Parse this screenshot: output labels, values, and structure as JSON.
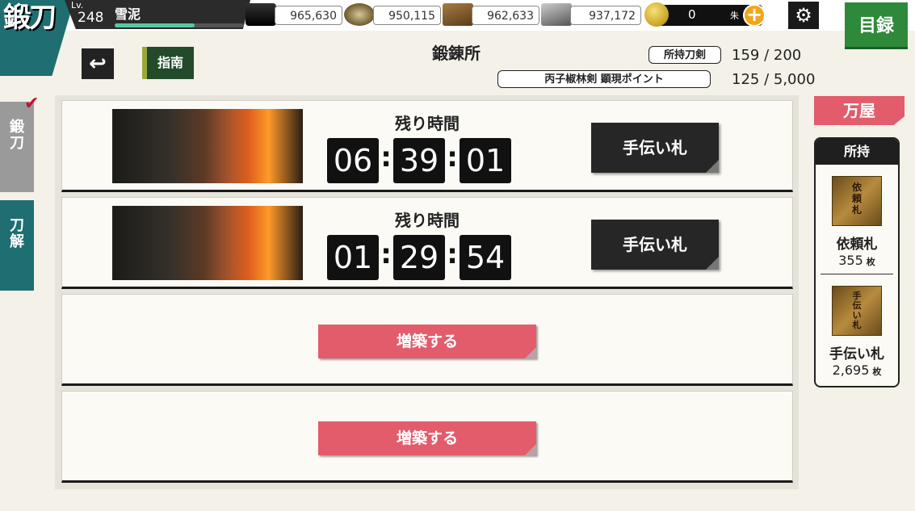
{
  "header": {
    "section_title": "鍛刀",
    "level_label": "Lv.",
    "level": "248",
    "player_name": "雪泥",
    "xp_progress": 0.62,
    "resources": [
      {
        "name": "charcoal",
        "icon": "charcoal-icon",
        "value": "965,630"
      },
      {
        "name": "tamahagane",
        "icon": "tamahagane-icon",
        "value": "950,115"
      },
      {
        "name": "cooling-material",
        "icon": "cooling-material-icon",
        "value": "962,633"
      },
      {
        "name": "whetstone",
        "icon": "whetstone-icon",
        "value": "937,172"
      }
    ],
    "currency": {
      "value": "0",
      "unit": "朱"
    },
    "catalog_label": "目録"
  },
  "subheader": {
    "guide_label": "指南",
    "page_title": "鍛錬所",
    "owned_swords_label": "所持刀剣",
    "owned_swords_value": "159 / 200",
    "points_label": "丙子椒林剣 顕現ポイント",
    "points_value": "125 / 5,000"
  },
  "side_tabs": {
    "forge": "鍛刀",
    "dismantle": "刀解"
  },
  "slots": [
    {
      "remaining_label": "残り時間",
      "hours": "06",
      "minutes": "39",
      "seconds": "01",
      "help_label": "手伝い札"
    },
    {
      "remaining_label": "残り時間",
      "hours": "01",
      "minutes": "29",
      "seconds": "54",
      "help_label": "手伝い札"
    },
    {
      "build_label": "増築する"
    },
    {
      "build_label": "増築する"
    }
  ],
  "shop": {
    "label": "万屋",
    "inventory_title": "所持",
    "items": [
      {
        "name": "依頼札",
        "count": "355",
        "unit": "枚",
        "tag_text": "依頼札"
      },
      {
        "name": "手伝い札",
        "count": "2,695",
        "unit": "枚",
        "tag_text": "手伝い札"
      }
    ]
  },
  "colors": {
    "teal": "#1e6e72",
    "pink": "#e35c6c",
    "green": "#2e8a3a"
  }
}
